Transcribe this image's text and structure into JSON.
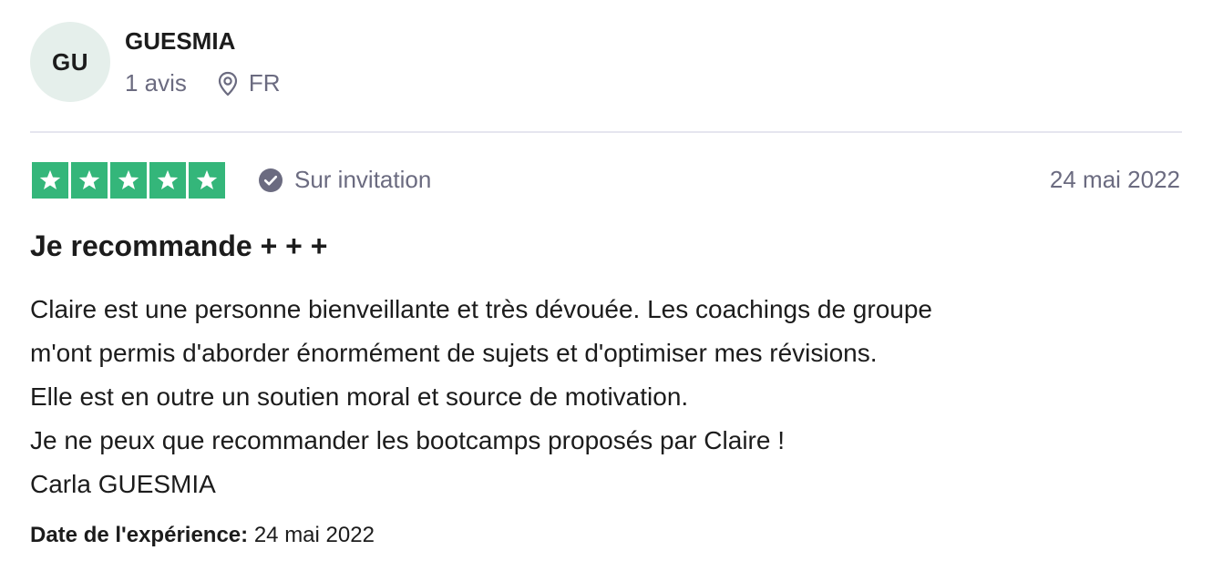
{
  "reviewer": {
    "initials": "GU",
    "name": "GUESMIA",
    "review_count": "1 avis",
    "country": "FR",
    "avatar_color": "#e5efeb"
  },
  "rating": {
    "stars": 5,
    "max_stars": 5,
    "star_color": "#34b67a",
    "invited_label": "Sur invitation",
    "date": "24 mai 2022"
  },
  "review": {
    "title": "Je recommande + + +",
    "lines": [
      "Claire est une personne bienveillante et très dévouée. Les coachings de groupe",
      "m'ont permis d'aborder énormément de sujets et d'optimiser mes révisions.",
      "Elle est en outre un soutien moral et source de motivation.",
      "Je ne peux que recommander les bootcamps proposés par Claire !",
      "Carla GUESMIA"
    ],
    "experience_label": "Date de l'expérience:",
    "experience_date": "24 mai 2022"
  },
  "icons": {
    "location": "map-pin-icon",
    "verified": "check-circle-icon",
    "star": "star-icon"
  }
}
